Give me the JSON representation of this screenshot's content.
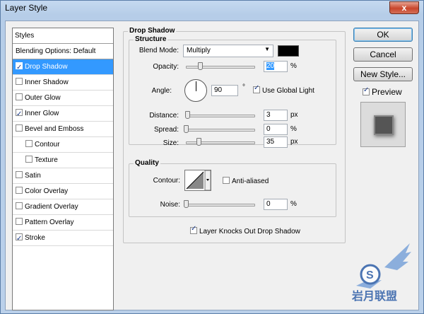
{
  "window": {
    "title": "Layer Style",
    "close_glyph": "x"
  },
  "sidebar": {
    "header": "Styles",
    "items": [
      {
        "label": "Blending Options: Default",
        "checkbox": false,
        "checked": false,
        "indent": false,
        "selected": false
      },
      {
        "label": "Drop Shadow",
        "checkbox": true,
        "checked": true,
        "indent": false,
        "selected": true
      },
      {
        "label": "Inner Shadow",
        "checkbox": true,
        "checked": false,
        "indent": false,
        "selected": false
      },
      {
        "label": "Outer Glow",
        "checkbox": true,
        "checked": false,
        "indent": false,
        "selected": false
      },
      {
        "label": "Inner Glow",
        "checkbox": true,
        "checked": true,
        "indent": false,
        "selected": false
      },
      {
        "label": "Bevel and Emboss",
        "checkbox": true,
        "checked": false,
        "indent": false,
        "selected": false
      },
      {
        "label": "Contour",
        "checkbox": true,
        "checked": false,
        "indent": true,
        "selected": false
      },
      {
        "label": "Texture",
        "checkbox": true,
        "checked": false,
        "indent": true,
        "selected": false
      },
      {
        "label": "Satin",
        "checkbox": true,
        "checked": false,
        "indent": false,
        "selected": false
      },
      {
        "label": "Color Overlay",
        "checkbox": true,
        "checked": false,
        "indent": false,
        "selected": false
      },
      {
        "label": "Gradient Overlay",
        "checkbox": true,
        "checked": false,
        "indent": false,
        "selected": false
      },
      {
        "label": "Pattern Overlay",
        "checkbox": true,
        "checked": false,
        "indent": false,
        "selected": false
      },
      {
        "label": "Stroke",
        "checkbox": true,
        "checked": true,
        "indent": false,
        "selected": false
      }
    ]
  },
  "drop_shadow": {
    "title": "Drop Shadow",
    "structure": {
      "title": "Structure",
      "blend_mode_label": "Blend Mode:",
      "blend_mode_value": "Multiply",
      "shadow_color": "#000000",
      "opacity_label": "Opacity:",
      "opacity_value": "20",
      "opacity_unit": "%",
      "opacity_fraction": 0.2,
      "angle_label": "Angle:",
      "angle_value": "90",
      "angle_unit": "°",
      "use_global_light_label": "Use Global Light",
      "use_global_light_checked": true,
      "distance_label": "Distance:",
      "distance_value": "3",
      "distance_unit": "px",
      "spread_label": "Spread:",
      "spread_value": "0",
      "spread_unit": "%",
      "size_label": "Size:",
      "size_value": "35",
      "size_unit": "px"
    },
    "quality": {
      "title": "Quality",
      "contour_label": "Contour:",
      "anti_aliased_label": "Anti-aliased",
      "anti_aliased_checked": false,
      "noise_label": "Noise:",
      "noise_value": "0",
      "noise_unit": "%"
    },
    "knocks_out_label": "Layer Knocks Out Drop Shadow",
    "knocks_out_checked": true
  },
  "buttons": {
    "ok": "OK",
    "cancel": "Cancel",
    "new_style": "New Style...",
    "preview_label": "Preview",
    "preview_checked": true
  },
  "colors": {
    "selection": "#3399ff",
    "dialog_bg": "#f0f0f0",
    "title_bar": "#b9d1ea"
  }
}
